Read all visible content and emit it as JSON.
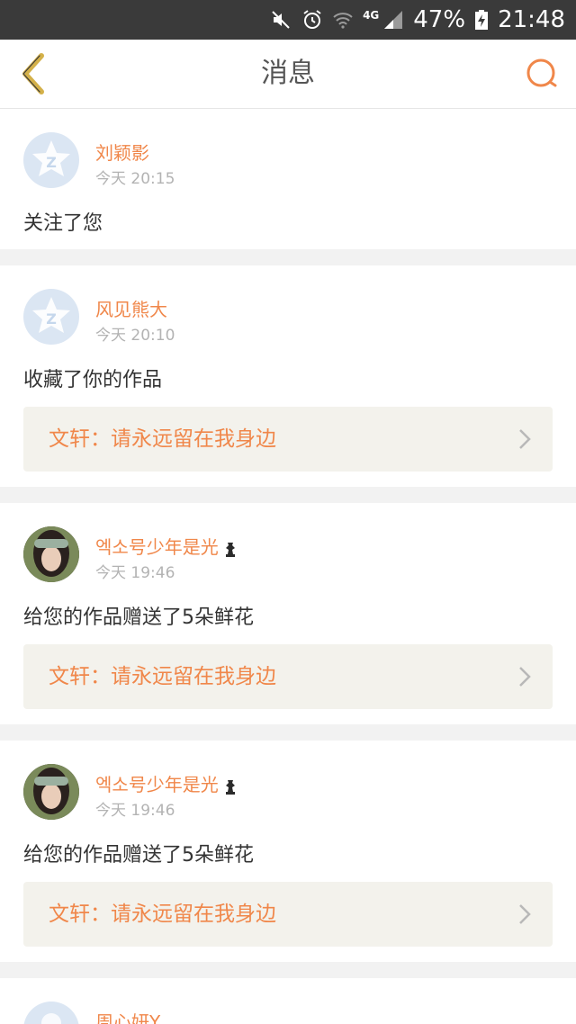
{
  "status_bar": {
    "battery": "47%",
    "time": "21:48",
    "network": "4G"
  },
  "header": {
    "title": "消息"
  },
  "notifications": [
    {
      "name": "刘颖影",
      "time": "今天 20:15",
      "message": "关注了您",
      "avatar": "default-avatar-icon"
    },
    {
      "name": "风见熊大",
      "time": "今天 20:10",
      "message": "收藏了你的作品",
      "work": "文轩：请永远留在我身边",
      "avatar": "default-avatar-icon"
    },
    {
      "name": "엑소号少年是光",
      "time": "今天 19:46",
      "message": "给您的作品赠送了5朵鲜花",
      "work": "文轩：请永远留在我身边",
      "avatar": "photo-avatar",
      "badge": "chess-piece-icon"
    },
    {
      "name": "엑소号少年是光",
      "time": "今天 19:46",
      "message": "给您的作品赠送了5朵鲜花",
      "work": "文轩：请永远留在我身边",
      "avatar": "photo-avatar",
      "badge": "chess-piece-icon"
    },
    {
      "name": "周心妍Y",
      "avatar": "default-avatar-icon"
    }
  ],
  "colors": {
    "accent": "#f0874a",
    "back_arrow": "#d4b14a",
    "status_bar": "#3a3a3a",
    "work_bg": "#f3f2ec"
  }
}
